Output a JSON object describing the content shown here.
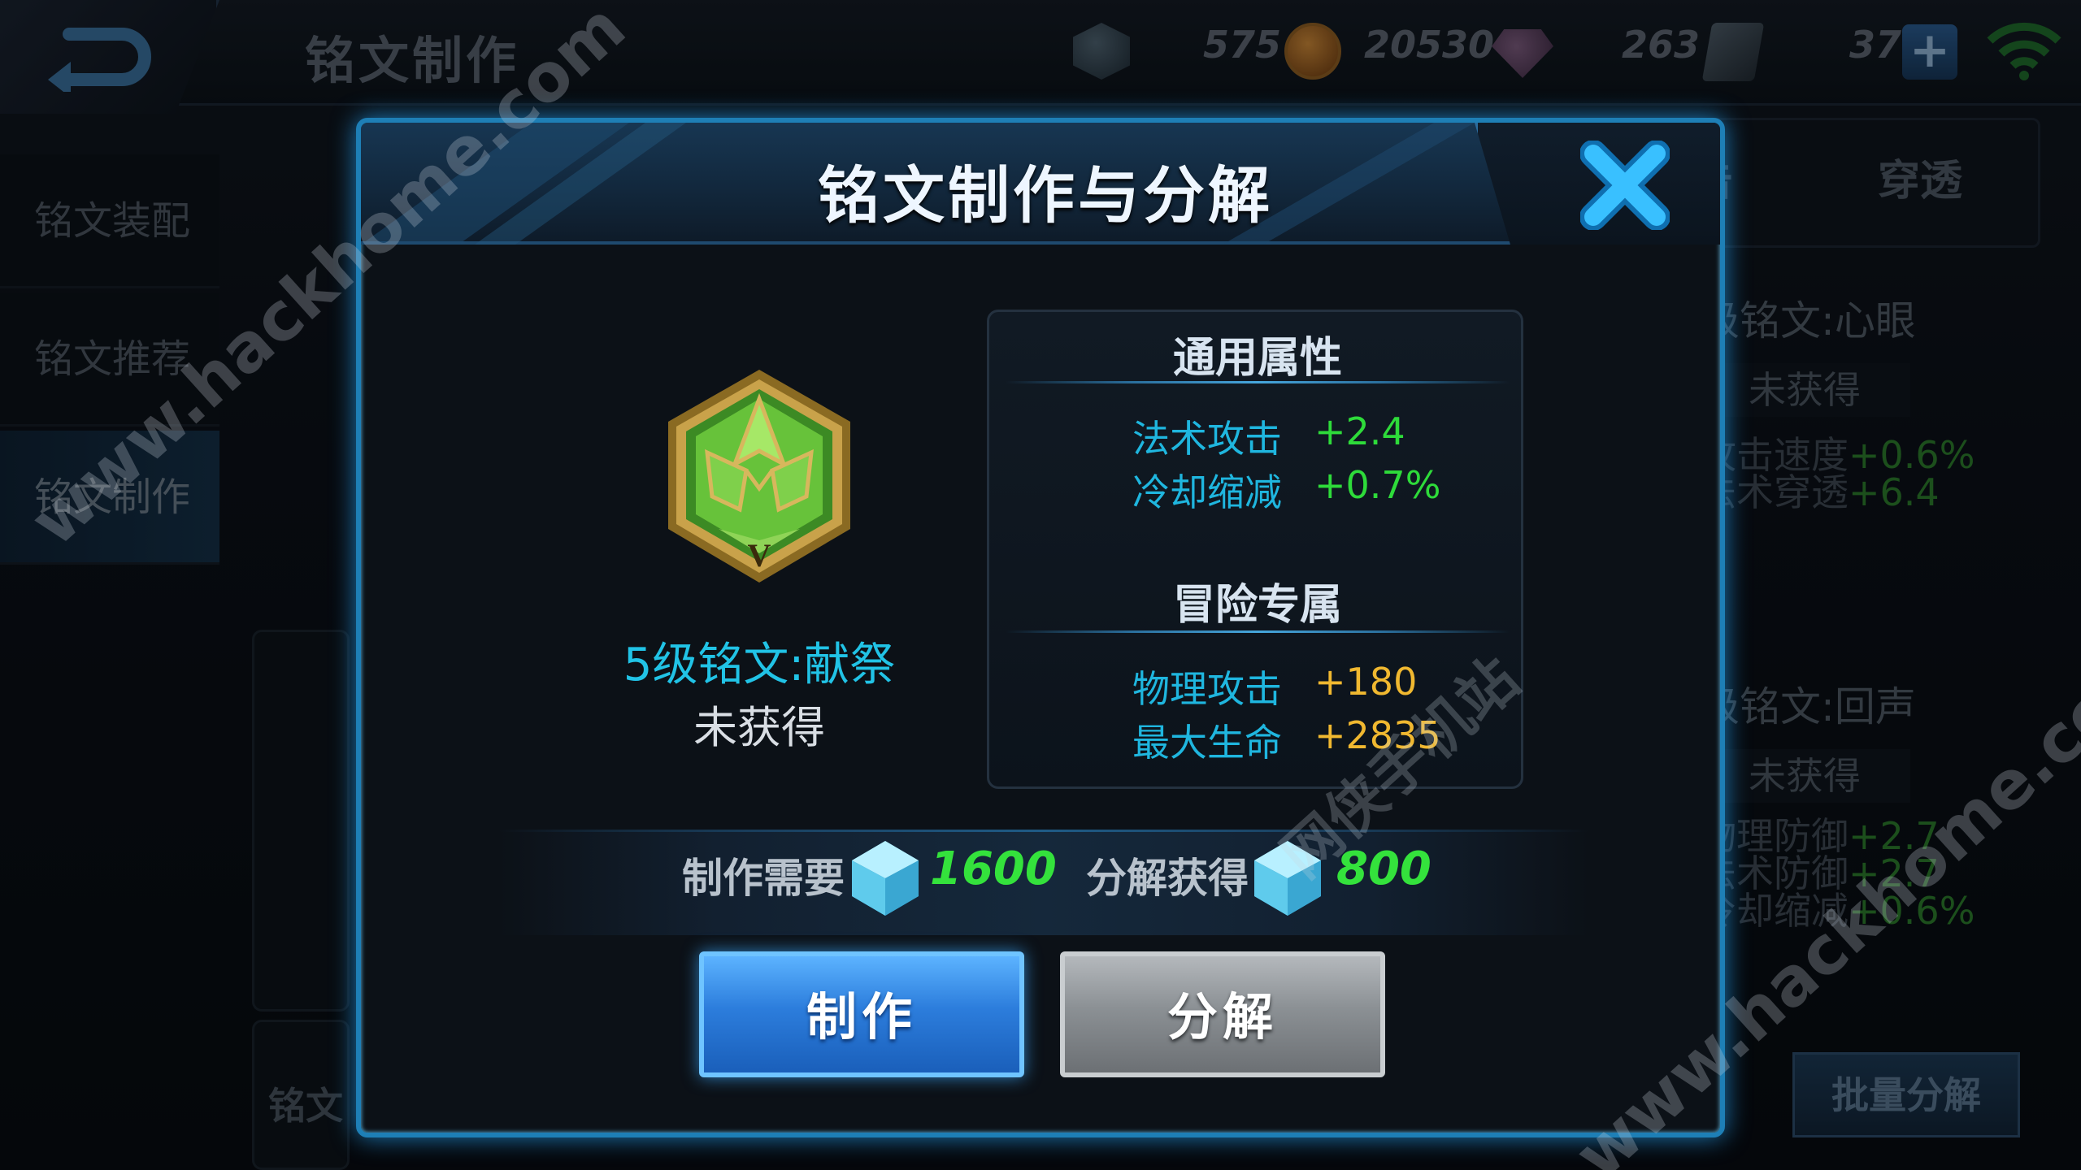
{
  "screen": {
    "title": "铭文制作",
    "resources": {
      "crystal_count": "575",
      "gold": "20530",
      "gems": "263",
      "tickets": "37"
    },
    "nav": {
      "equip": "铭文装配",
      "recommend": "铭文推荐",
      "craft": "铭文制作"
    },
    "bg_tabs": {
      "crit": "击",
      "penetration": "穿透"
    },
    "bg_cards": [
      {
        "name": "级铭文:心眼",
        "state": "未获得",
        "stats": [
          {
            "k": "攻击速度",
            "v": "+0.6%"
          },
          {
            "k": "法术穿透",
            "v": "+6.4"
          }
        ]
      },
      {
        "name": "级铭文:回声",
        "state": "未获得",
        "stats": [
          {
            "k": "物理防御",
            "v": "+2.7"
          },
          {
            "k": "法术防御",
            "v": "+2.7"
          },
          {
            "k": "冷却缩减",
            "v": "+0.6%"
          }
        ]
      }
    ],
    "batch_decompose": "批量分解",
    "bottom_label": "铭文"
  },
  "dialog": {
    "title": "铭文制作与分解",
    "inscription": {
      "name": "5级铭文:献祭",
      "status": "未获得",
      "level_mark": "V"
    },
    "general": {
      "heading": "通用属性",
      "rows": [
        {
          "k": "法术攻击",
          "v": "+2.4"
        },
        {
          "k": "冷却缩减",
          "v": "+0.7%"
        }
      ]
    },
    "adventure": {
      "heading": "冒险专属",
      "rows": [
        {
          "k": "物理攻击",
          "v": "+180"
        },
        {
          "k": "最大生命",
          "v": "+2835"
        }
      ]
    },
    "craft_cost": {
      "label": "制作需要",
      "value": "1600"
    },
    "decompose_gain": {
      "label": "分解获得",
      "value": "800"
    },
    "craft_label": "制作",
    "decompose_label": "分解"
  },
  "watermarks": {
    "site": "www.hackhome.com",
    "site_cn": "网侠手机站"
  },
  "colors": {
    "accent_blue": "#1e7fb6",
    "attr_key": "#1fb6df",
    "value_green": "#2edb3a",
    "value_gold": "#f0b830"
  }
}
